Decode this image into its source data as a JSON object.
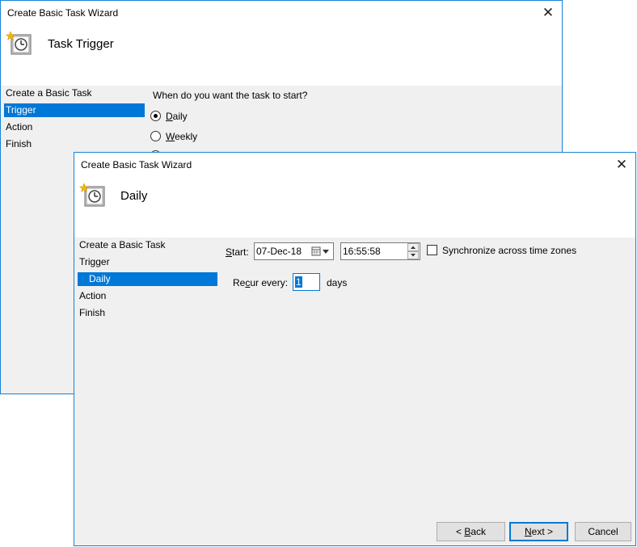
{
  "back_window": {
    "title": "Create Basic Task Wizard",
    "close_glyph": "✕",
    "header_title": "Task Trigger",
    "nav": [
      "Create a Basic Task",
      "Trigger",
      "Action",
      "Finish"
    ],
    "prompt": "When do you want the task to start?",
    "options": [
      {
        "label_u": "D",
        "label_rest": "aily",
        "checked": true
      },
      {
        "label_u": "W",
        "label_rest": "eekly",
        "checked": false
      }
    ]
  },
  "front_window": {
    "title": "Create Basic Task Wizard",
    "close_glyph": "✕",
    "header_title": "Daily",
    "nav": [
      "Create a Basic Task",
      "Trigger",
      "Daily",
      "Action",
      "Finish"
    ],
    "start_label_u": "S",
    "start_label_rest": "tart:",
    "start_date": "07-Dec-18",
    "start_time": "16:55:58",
    "sync_label": "Synchronize across time zones",
    "recur_pre": "Re",
    "recur_u": "c",
    "recur_post": "ur every:",
    "recur_value": "1",
    "days_label": "days",
    "buttons": {
      "back_pre": "< ",
      "back_u": "B",
      "back_post": "ack",
      "next_u": "N",
      "next_post": "ext >",
      "cancel": "Cancel"
    }
  },
  "icons": {
    "task_icon": "clock-calendar-icon",
    "calendar": "calendar-dropdown-icon",
    "spin": "spinner-arrows-icon"
  },
  "colors": {
    "accent": "#0078d7",
    "border": "#1883d7",
    "panel_bg": "#f0f0f0"
  }
}
